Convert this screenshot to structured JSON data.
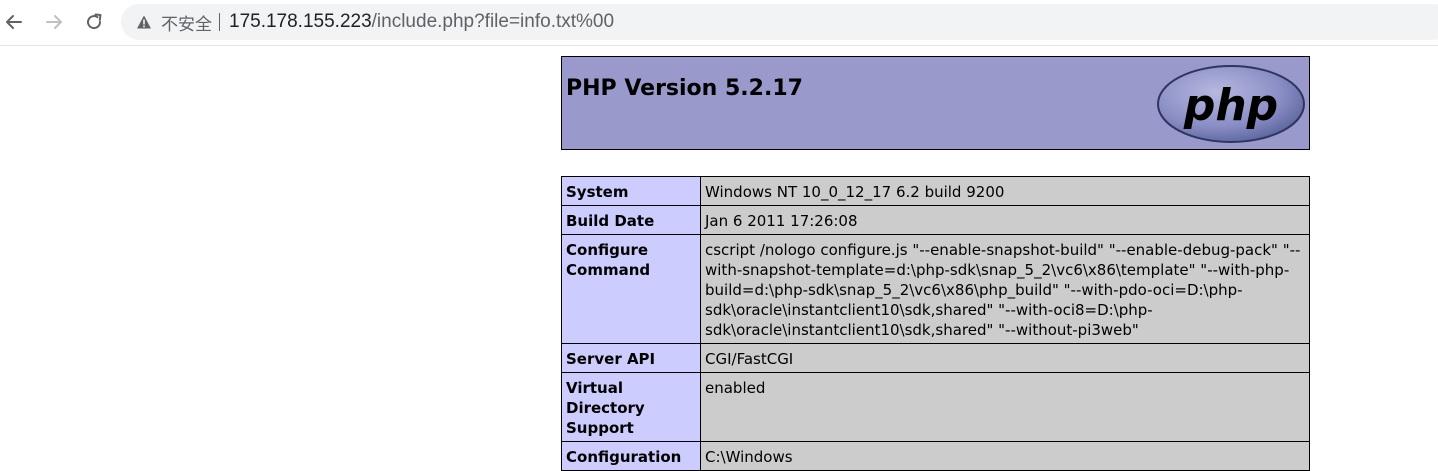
{
  "browser": {
    "insecure_label": "不安全",
    "url_host": "175.178.155.223",
    "url_path": "/include.php?file=info.txt%00"
  },
  "php": {
    "title": "PHP Version 5.2.17",
    "logo_text": "php"
  },
  "rows": [
    {
      "key": "System",
      "value": "Windows NT 10_0_12_17 6.2 build 9200"
    },
    {
      "key": "Build Date",
      "value": "Jan 6 2011 17:26:08"
    },
    {
      "key": "Configure Command",
      "value": "cscript /nologo configure.js \"--enable-snapshot-build\" \"--enable-debug-pack\" \"--with-snapshot-template=d:\\php-sdk\\snap_5_2\\vc6\\x86\\template\" \"--with-php-build=d:\\php-sdk\\snap_5_2\\vc6\\x86\\php_build\" \"--with-pdo-oci=D:\\php-sdk\\oracle\\instantclient10\\sdk,shared\" \"--with-oci8=D:\\php-sdk\\oracle\\instantclient10\\sdk,shared\" \"--without-pi3web\""
    },
    {
      "key": "Server API",
      "value": "CGI/FastCGI"
    },
    {
      "key": "Virtual Directory Support",
      "value": "enabled"
    },
    {
      "key": "Configuration",
      "value": "C:\\Windows"
    }
  ],
  "colors": {
    "header_bg": "#9999cc",
    "key_bg": "#ccccff",
    "value_bg": "#cccccc"
  }
}
